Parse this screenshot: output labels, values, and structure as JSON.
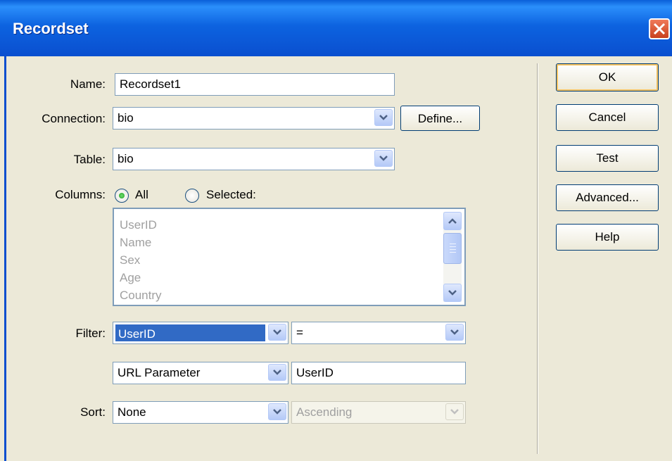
{
  "window": {
    "title": "Recordset"
  },
  "form": {
    "name_label": "Name:",
    "name_value": "Recordset1",
    "connection_label": "Connection:",
    "connection_value": "bio",
    "define_button": "Define...",
    "table_label": "Table:",
    "table_value": "bio",
    "columns_label": "Columns:",
    "columns_all_label": "All",
    "columns_selected_label": "Selected:",
    "columns_selected_option": "All",
    "columns_list": [
      "UserID",
      "Name",
      "Sex",
      "Age",
      "Country"
    ],
    "filter_label": "Filter:",
    "filter_column": "UserID",
    "filter_operator": "=",
    "filter_source": "URL Parameter",
    "filter_value": "UserID",
    "sort_label": "Sort:",
    "sort_column": "None",
    "sort_order": "Ascending"
  },
  "buttons": {
    "ok": "OK",
    "cancel": "Cancel",
    "test": "Test",
    "advanced": "Advanced...",
    "help": "Help"
  },
  "colors": {
    "titlebar": "#0a5fd8",
    "dialog_bg": "#ece9d8",
    "selection": "#316ac5"
  }
}
